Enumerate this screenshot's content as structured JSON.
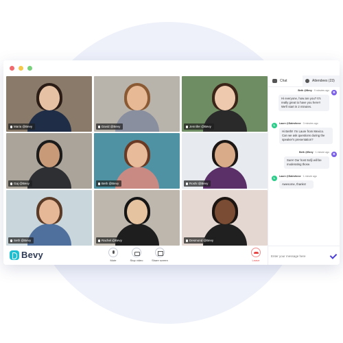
{
  "window": {
    "controls": [
      "close",
      "minimize",
      "maximize"
    ]
  },
  "participants": [
    {
      "name": "Maria @Bevy",
      "bg": "#8a7a6a",
      "skin": "#e7c1a3",
      "hair": "#2b1d16",
      "shirt": "#1f2d46"
    },
    {
      "name": "David @Bevy",
      "bg": "#b9b4ab",
      "skin": "#e8b995",
      "hair": "#8a5a34",
      "shirt": "#8a8fa0"
    },
    {
      "name": "Jennifer @Bevy",
      "bg": "#6f8d63",
      "skin": "#efc9ad",
      "hair": "#3b2418",
      "shirt": "#2a2a2a"
    },
    {
      "name": "Gaj @Bevy",
      "bg": "#aaa49a",
      "skin": "#c89a78",
      "hair": "#1b1b1b",
      "shirt": "#2e2f33"
    },
    {
      "name": "Beth @Bevy",
      "bg": "#4f92a3",
      "skin": "#e8bc9b",
      "hair": "#6b3a24",
      "shirt": "#c98a84"
    },
    {
      "name": "Roshi @Bevy",
      "bg": "#e7ebf0",
      "skin": "#d9ab88",
      "hair": "#1c1714",
      "shirt": "#5b2f68"
    },
    {
      "name": "Seth @Bevy",
      "bg": "#c9d6dc",
      "skin": "#e7b898",
      "hair": "#5a3b27",
      "shirt": "#4f6f9c"
    },
    {
      "name": "Rachel @Bevy",
      "bg": "#bdb7ae",
      "skin": "#e5c3a1",
      "hair": "#151515",
      "shirt": "#1e1e1e"
    },
    {
      "name": "Desmond @Bevy",
      "bg": "#e4d7d1",
      "skin": "#7a4c33",
      "hair": "#1b1410",
      "shirt": "#202020"
    }
  ],
  "toolbar": {
    "logo_text": "Bevy",
    "mute_label": "Mute",
    "stop_video_label": "Stop video",
    "share_screen_label": "Share screen",
    "leave_label": "Leave"
  },
  "chat": {
    "tab_chat": "Chat",
    "tab_attendees": "Attendees (23)",
    "messages": [
      {
        "sender": "Beth @Bevy",
        "time": "9 minutes ago",
        "avatar": "B",
        "side": "right",
        "text": "Hi everyone, how are you? It's really great to have you here!! We'll start in 2 minutes."
      },
      {
        "sender": "Laure @Salesforce",
        "time": "3 minutes ago",
        "avatar": "L",
        "side": "left",
        "text": "Hi Beth!! I'm Laure from Mexico. Can we ask questions during the speaker's presentation?"
      },
      {
        "sender": "Beth @Bevy",
        "time": "1 minute ago",
        "avatar": "B",
        "side": "right",
        "text": "Sure! Our host Sofji will be moderating those."
      },
      {
        "sender": "Laure @Salesforce",
        "time": "1 minute ago",
        "avatar": "L",
        "side": "left",
        "text": "Awesome, thanks!"
      }
    ],
    "input_placeholder": "Enter your message here"
  },
  "colors": {
    "accent": "#4b3fd6",
    "brand": "#1dbfd0",
    "leave": "#e84545"
  }
}
